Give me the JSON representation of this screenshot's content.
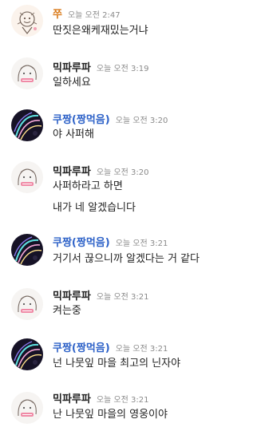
{
  "colors": {
    "name_default": "#222222",
    "name_orange": "#d97a1a",
    "name_blue": "#2e62c8",
    "time": "#8a8a8a",
    "text": "#1f1f1f"
  },
  "messages": [
    {
      "author": "쭈",
      "author_color": "#d97a1a",
      "time": "오늘 오전 2:47",
      "avatar": "sketch-doodle-avatar",
      "lines": [
        "딴짓은왜케재밌는거냐"
      ]
    },
    {
      "author": "믹파루파",
      "author_color": "#222222",
      "time": "오늘 오전 3:19",
      "avatar": "sketch-face-avatar",
      "lines": [
        "일하세요"
      ]
    },
    {
      "author": "쿠짱(짱먹음)",
      "author_color": "#2e62c8",
      "time": "오늘 오전 3:20",
      "avatar": "dark-swirl-avatar",
      "lines": [
        "야 사퍼해"
      ]
    },
    {
      "author": "믹파루파",
      "author_color": "#222222",
      "time": "오늘 오전 3:20",
      "avatar": "sketch-face-avatar",
      "lines": [
        "사퍼하라고 하면",
        "내가 네 알겠습니다"
      ]
    },
    {
      "author": "쿠짱(짱먹음)",
      "author_color": "#2e62c8",
      "time": "오늘 오전 3:21",
      "avatar": "dark-swirl-avatar",
      "lines": [
        "거기서 끊으니까 알겠다는 거 같다"
      ]
    },
    {
      "author": "믹파루파",
      "author_color": "#222222",
      "time": "오늘 오전 3:21",
      "avatar": "sketch-face-avatar",
      "lines": [
        "켜는중"
      ]
    },
    {
      "author": "쿠짱(짱먹음)",
      "author_color": "#2e62c8",
      "time": "오늘 오전 3:21",
      "avatar": "dark-swirl-avatar",
      "lines": [
        "넌 나뭇잎 마을 최고의 닌자야"
      ]
    },
    {
      "author": "믹파루파",
      "author_color": "#222222",
      "time": "오늘 오전 3:21",
      "avatar": "sketch-face-avatar",
      "lines": [
        "난 나뭇잎 마을의 영웅이야"
      ]
    }
  ]
}
